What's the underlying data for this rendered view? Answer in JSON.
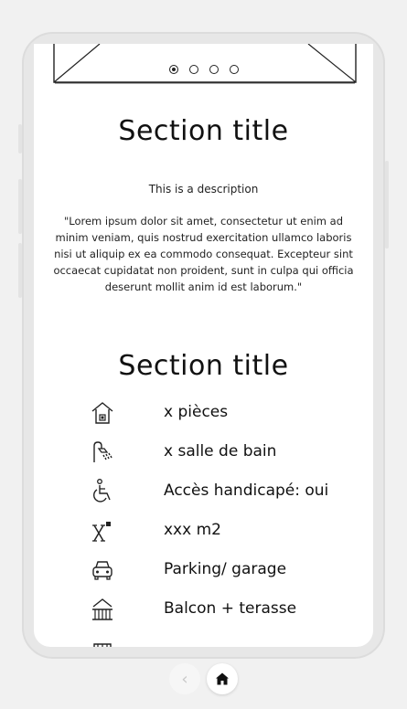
{
  "carousel": {
    "dots": 4,
    "active_index": 0
  },
  "section1": {
    "title": "Section title",
    "description": "This is a description",
    "quote": "\"Lorem ipsum dolor sit amet, consectetur ut enim ad minim veniam, quis nostrud exercitation ullamco laboris nisi ut aliquip ex ea commodo consequat. Excepteur sint occaecat cupidatat non proident, sunt in culpa qui officia deserunt mollit anim id est laborum.\""
  },
  "section2": {
    "title": "Section title",
    "features": [
      {
        "icon": "house-icon",
        "label": "x pièces"
      },
      {
        "icon": "shower-icon",
        "label": "x salle de bain"
      },
      {
        "icon": "wheelchair-icon",
        "label": "Accès handicapé: oui"
      },
      {
        "icon": "area-icon",
        "label": "xxx m2"
      },
      {
        "icon": "car-icon",
        "label": "Parking/ garage"
      },
      {
        "icon": "balcony-icon",
        "label": "Balcon + terasse"
      }
    ]
  },
  "nav": {
    "back_symbol": "‹"
  }
}
